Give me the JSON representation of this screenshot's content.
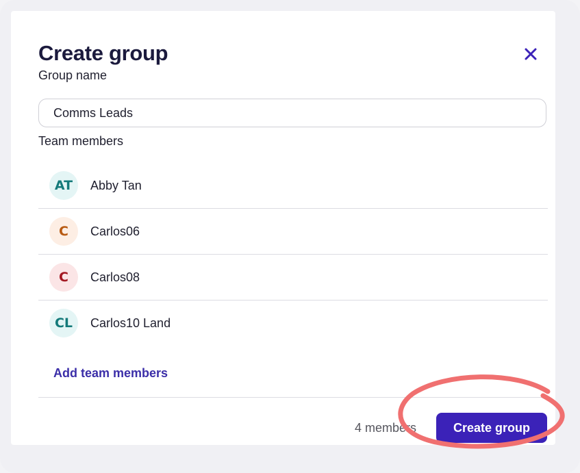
{
  "modal": {
    "title": "Create group",
    "close_icon": "close-icon"
  },
  "group_name": {
    "label": "Group name",
    "value": "Comms Leads"
  },
  "team_members": {
    "label": "Team members",
    "items": [
      {
        "initials": "AT",
        "name": "Abby Tan",
        "avatar_bg": "#e4f5f5",
        "avatar_fg": "#147a7a"
      },
      {
        "initials": "C",
        "name": "Carlos06",
        "avatar_bg": "#fdeee4",
        "avatar_fg": "#b85a12"
      },
      {
        "initials": "C",
        "name": "Carlos08",
        "avatar_bg": "#fbe5e6",
        "avatar_fg": "#a31822"
      },
      {
        "initials": "CL",
        "name": "Carlos10 Land",
        "avatar_bg": "#e4f5f5",
        "avatar_fg": "#147a7a"
      }
    ]
  },
  "add_members_link": "Add team members",
  "footer": {
    "member_count": "4 members",
    "create_button": "Create group"
  },
  "colors": {
    "accent": "#3b22b8",
    "link": "#3b2ea8",
    "annotation": "#f07070"
  }
}
